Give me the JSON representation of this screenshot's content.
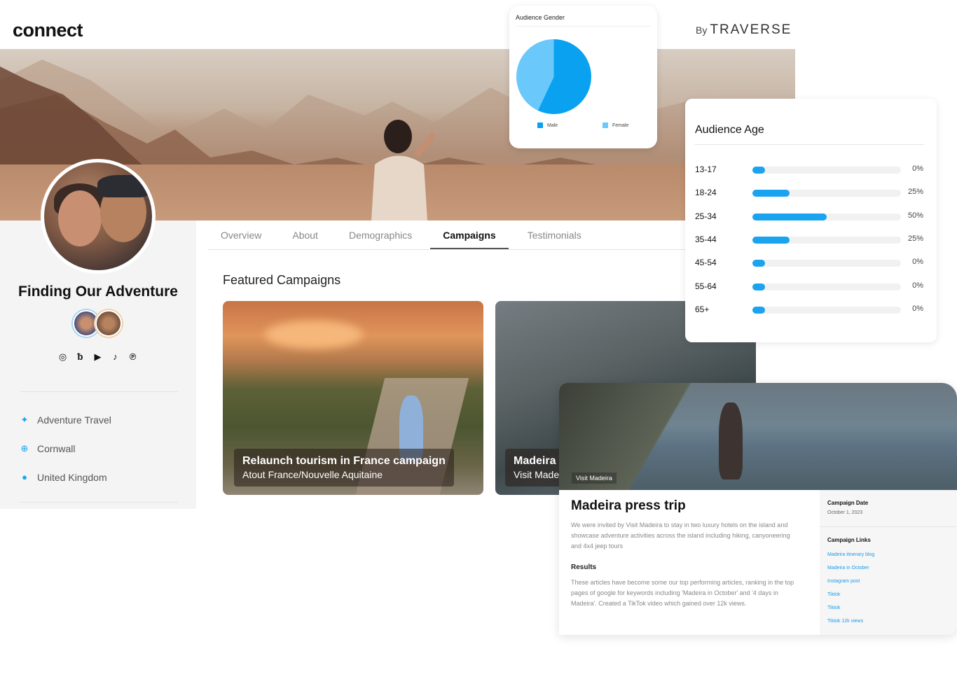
{
  "brand": {
    "logo": "connect",
    "by": "By",
    "partner": "TRAVERSE"
  },
  "profile": {
    "name": "Finding Our Adventure",
    "socials": [
      "instagram-icon",
      "blog-icon",
      "youtube-icon",
      "tiktok-icon",
      "pinterest-icon"
    ],
    "tags": [
      {
        "icon": "hiker-icon",
        "label": "Adventure Travel"
      },
      {
        "icon": "target-icon",
        "label": "Cornwall"
      },
      {
        "icon": "location-pin-icon",
        "label": "United Kingdom"
      }
    ]
  },
  "tabs": [
    {
      "label": "Overview"
    },
    {
      "label": "About"
    },
    {
      "label": "Demographics"
    },
    {
      "label": "Campaigns",
      "active": true
    },
    {
      "label": "Testimonials"
    }
  ],
  "featured": {
    "title": "Featured Campaigns",
    "cards": [
      {
        "title": "Relaunch tourism in France campaign",
        "subtitle": "Atout France/Nouvelle Aquitaine"
      },
      {
        "title": "Madeira",
        "subtitle": "Visit Made"
      }
    ]
  },
  "gender": {
    "title": "Audience Gender",
    "slices": [
      {
        "label": "Male",
        "percent": 57,
        "color": "#0aa2f0"
      },
      {
        "label": "Female",
        "percent": 43,
        "color": "#6bc8fb"
      }
    ]
  },
  "age": {
    "title": "Audience Age",
    "rows": [
      {
        "label": "13-17",
        "value": "0%",
        "fraction": 0.0
      },
      {
        "label": "18-24",
        "value": "25%",
        "fraction": 0.25
      },
      {
        "label": "25-34",
        "value": "50%",
        "fraction": 0.5
      },
      {
        "label": "35-44",
        "value": "25%",
        "fraction": 0.25
      },
      {
        "label": "45-54",
        "value": "0%",
        "fraction": 0.0
      },
      {
        "label": "55-64",
        "value": "0%",
        "fraction": 0.0
      },
      {
        "label": "65+",
        "value": "0%",
        "fraction": 0.0
      }
    ],
    "accent": "#1aa3ef"
  },
  "detail": {
    "chip": "Visit Madeira",
    "title": "Madeira press trip",
    "description": "We were invited by Visit Madeira to stay in two luxury hotels on the island and showcase adventure activities across the island including hiking, canyoneering and 4x4 jeep tours",
    "results_heading": "Results",
    "results": "These articles have become some our top performing articles, ranking in the top pages of google for keywords including 'Madeira in October' and '4 days in Madeira'. Created a TikTok video which gained over 12k views.",
    "date_heading": "Campaign Date",
    "date": "October 1, 2023",
    "links_heading": "Campaign Links",
    "links": [
      "Madeira itinerary blog",
      "Madeira in October",
      "Instagram post",
      "Tiktok",
      "Tiktok",
      "Tiktok 12k views"
    ]
  }
}
